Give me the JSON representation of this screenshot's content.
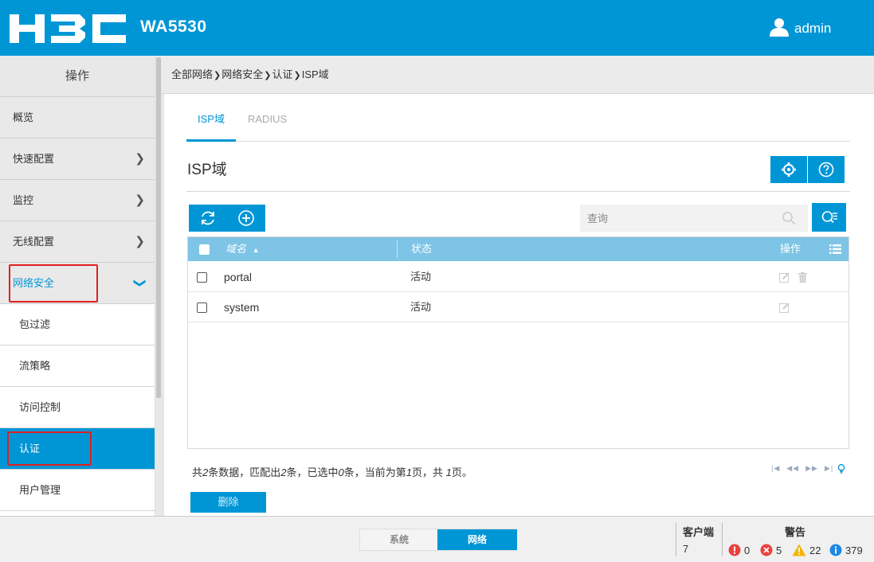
{
  "header": {
    "logo_text": "H3C",
    "model": "WA5530",
    "user": "admin"
  },
  "sidebar": {
    "title": "操作",
    "items": [
      {
        "label": "概览"
      },
      {
        "label": "快速配置"
      },
      {
        "label": "监控"
      },
      {
        "label": "无线配置"
      },
      {
        "label": "网络安全"
      }
    ],
    "sub_items": [
      {
        "label": "包过滤"
      },
      {
        "label": "流策略"
      },
      {
        "label": "访问控制"
      },
      {
        "label": "认证"
      },
      {
        "label": "用户管理"
      }
    ]
  },
  "breadcrumb": [
    "全部网络",
    "网络安全",
    "认证",
    "ISP域"
  ],
  "tabs": [
    {
      "label": "ISP域",
      "active": true
    },
    {
      "label": "RADIUS",
      "active": false
    }
  ],
  "section_title": "ISP域",
  "search": {
    "placeholder": "查询"
  },
  "table": {
    "headers": {
      "name": "域名",
      "status": "状态",
      "action": "操作"
    },
    "rows": [
      {
        "name": "portal",
        "status": "活动"
      },
      {
        "name": "system",
        "status": "活动"
      }
    ]
  },
  "summary": {
    "p1": "共",
    "total": "2",
    "p2": "条数据，匹配出",
    "matched": "2",
    "p3": "条，已选中",
    "selected": "0",
    "p4": "条，当前为第",
    "page": "1",
    "p5": "页，共",
    "pages": "1",
    "p6": "页。"
  },
  "pager": [
    "|◀",
    "◀◀",
    "▶▶",
    "▶|"
  ],
  "delete_label": "删除",
  "footer": {
    "modes": [
      "系统",
      "网络"
    ],
    "active_mode": "网络",
    "clients_label": "客户端",
    "clients_value": "7",
    "alarms_label": "警告",
    "alarms": [
      {
        "type": "critical",
        "count": "0",
        "color": "#e8413c"
      },
      {
        "type": "error",
        "count": "5",
        "color": "#e8413c"
      },
      {
        "type": "warning",
        "count": "22",
        "color": "#f4b400"
      },
      {
        "type": "info",
        "count": "379",
        "color": "#1e88e5"
      }
    ]
  },
  "colors": {
    "accent": "#0096d6",
    "grid_header": "#7dc4e6",
    "highlight": "#e02020"
  }
}
